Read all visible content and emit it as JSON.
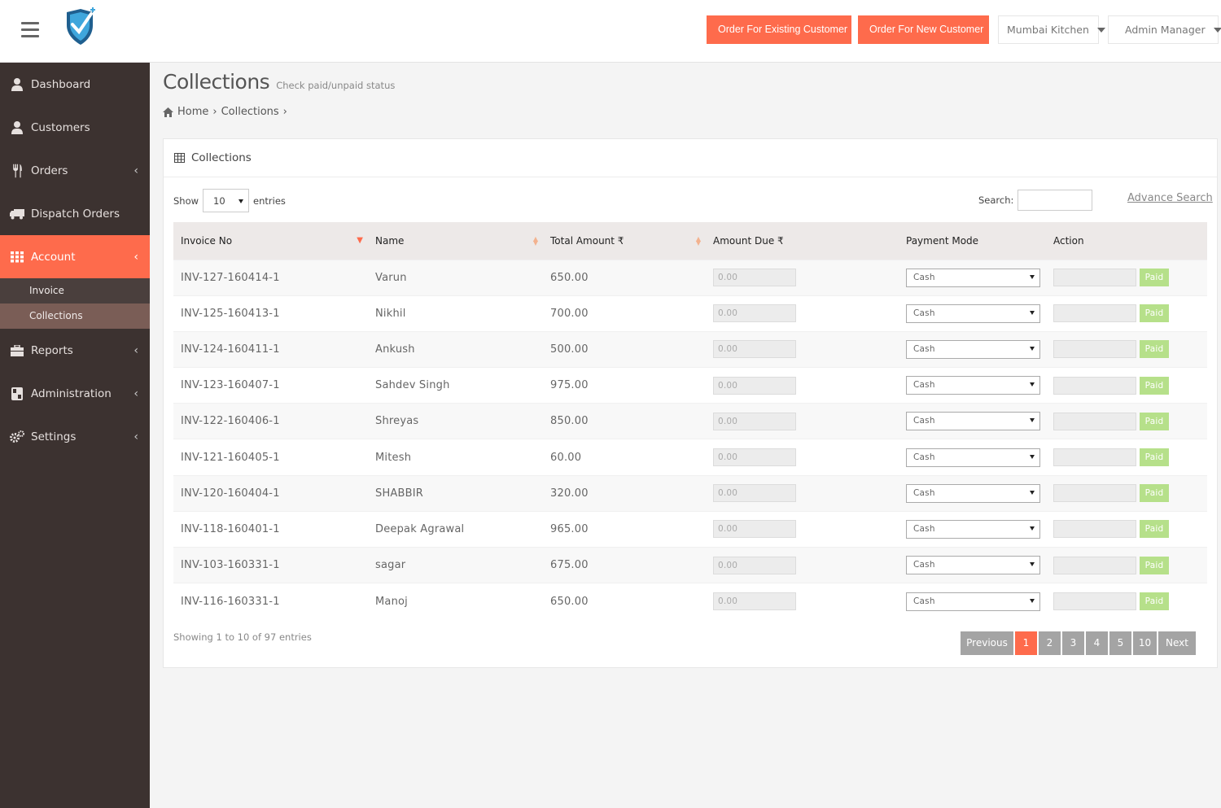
{
  "header": {
    "btn_existing": "Order For Existing Customer",
    "btn_new": "Order For New Customer",
    "kitchen": "Mumbai Kitchen",
    "user": "Admin Manager"
  },
  "sidebar": {
    "items": [
      {
        "label": "Dashboard"
      },
      {
        "label": "Customers"
      },
      {
        "label": "Orders"
      },
      {
        "label": "Dispatch Orders"
      },
      {
        "label": "Account"
      },
      {
        "label": "Reports"
      },
      {
        "label": "Administration"
      },
      {
        "label": "Settings"
      }
    ],
    "account_sub": [
      "Invoice",
      "Collections"
    ]
  },
  "page": {
    "title": "Collections",
    "subtitle": "Check paid/unpaid status",
    "breadcrumb_home": "Home",
    "breadcrumb_current": "Collections"
  },
  "panel": {
    "title": "Collections",
    "show_label": "Show",
    "entries_value": "10",
    "entries_label": "entries",
    "search_label": "Search:",
    "advance_search": "Advance Search",
    "info": "Showing 1 to 10 of 97 entries"
  },
  "table": {
    "headers": [
      "Invoice No",
      "Name",
      "Total Amount ₹",
      "Amount Due ₹",
      "Payment Mode",
      "Action"
    ],
    "rows": [
      {
        "invoice": "INV-127-160414-1",
        "name": "Varun",
        "total": "650.00",
        "due": "0.00",
        "mode": "Cash",
        "action": "Paid"
      },
      {
        "invoice": "INV-125-160413-1",
        "name": "Nikhil",
        "total": "700.00",
        "due": "0.00",
        "mode": "Cash",
        "action": "Paid"
      },
      {
        "invoice": "INV-124-160411-1",
        "name": "Ankush",
        "total": "500.00",
        "due": "0.00",
        "mode": "Cash",
        "action": "Paid"
      },
      {
        "invoice": "INV-123-160407-1",
        "name": "Sahdev Singh",
        "total": "975.00",
        "due": "0.00",
        "mode": "Cash",
        "action": "Paid"
      },
      {
        "invoice": "INV-122-160406-1",
        "name": "Shreyas",
        "total": "850.00",
        "due": "0.00",
        "mode": "Cash",
        "action": "Paid"
      },
      {
        "invoice": "INV-121-160405-1",
        "name": "Mitesh",
        "total": "60.00",
        "due": "0.00",
        "mode": "Cash",
        "action": "Paid"
      },
      {
        "invoice": "INV-120-160404-1",
        "name": "SHABBIR",
        "total": "320.00",
        "due": "0.00",
        "mode": "Cash",
        "action": "Paid"
      },
      {
        "invoice": "INV-118-160401-1",
        "name": "Deepak Agrawal",
        "total": "965.00",
        "due": "0.00",
        "mode": "Cash",
        "action": "Paid"
      },
      {
        "invoice": "INV-103-160331-1",
        "name": "sagar",
        "total": "675.00",
        "due": "0.00",
        "mode": "Cash",
        "action": "Paid"
      },
      {
        "invoice": "INV-116-160331-1",
        "name": "Manoj",
        "total": "650.00",
        "due": "0.00",
        "mode": "Cash",
        "action": "Paid"
      }
    ]
  },
  "pagination": {
    "previous": "Previous",
    "pages": [
      "1",
      "2",
      "3",
      "4",
      "5",
      "10"
    ],
    "next": "Next"
  },
  "colors": {
    "accent": "#fe6b4c",
    "sidebar": "#3c3230",
    "paid": "#b6e08a"
  },
  "icons": [
    "menu-icon",
    "shield-logo-icon",
    "cutlery-icon",
    "user-icon",
    "truck-icon",
    "grid-icon",
    "briefcase-icon",
    "gears-icon",
    "home-icon",
    "table-icon",
    "chevron-left-icon"
  ]
}
